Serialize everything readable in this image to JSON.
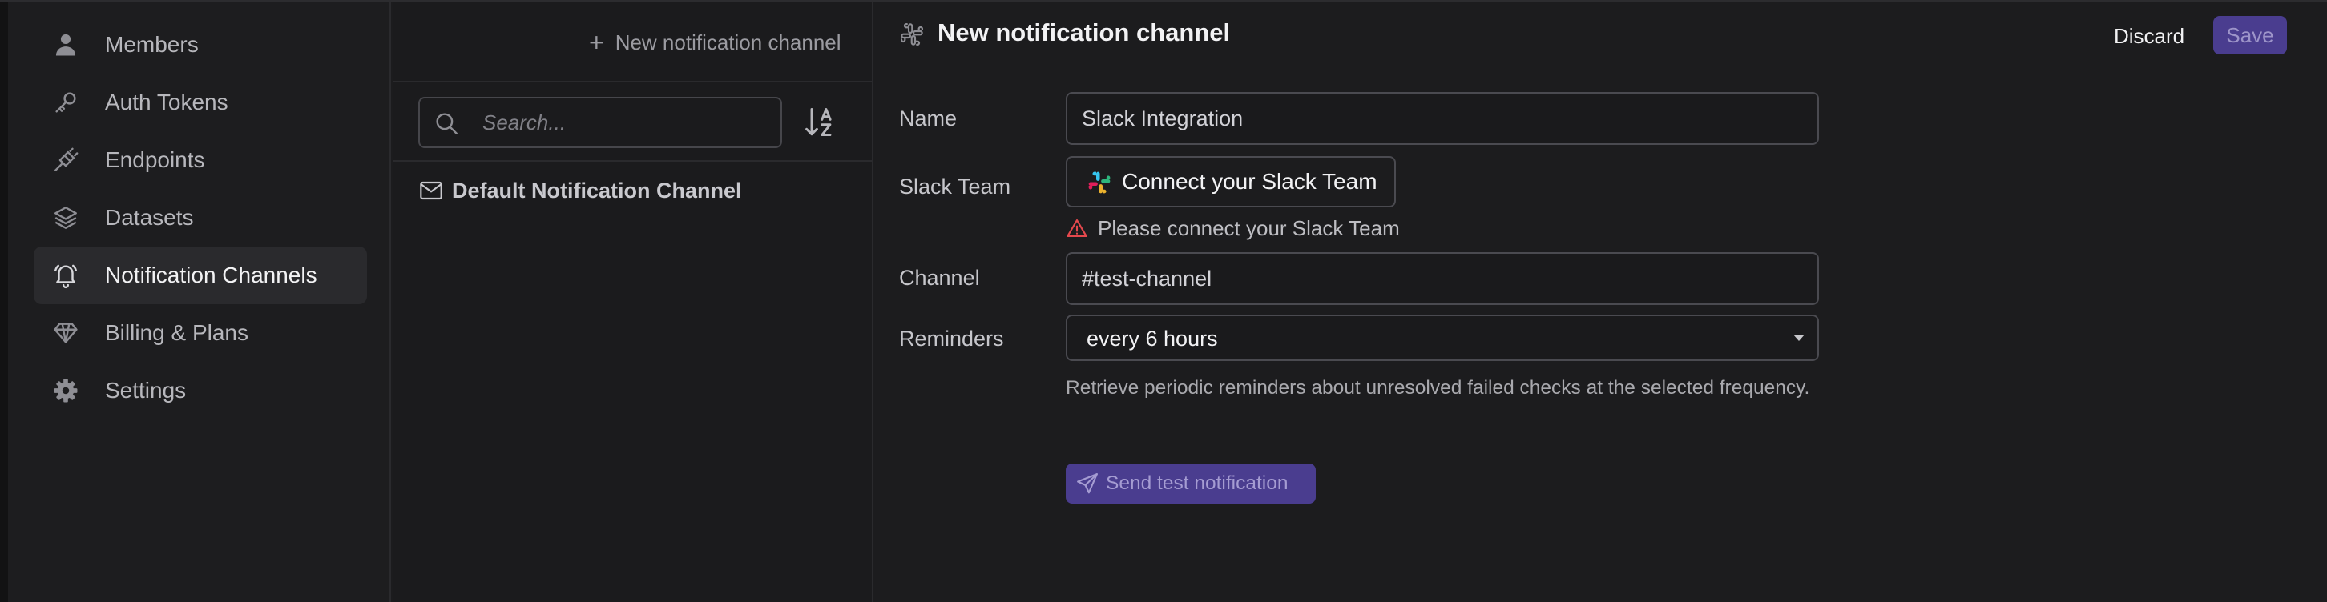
{
  "sidebar": {
    "items": [
      {
        "label": "Members",
        "icon": "user-icon",
        "active": false
      },
      {
        "label": "Auth Tokens",
        "icon": "key-icon",
        "active": false
      },
      {
        "label": "Endpoints",
        "icon": "plug-icon",
        "active": false
      },
      {
        "label": "Datasets",
        "icon": "layers-icon",
        "active": false
      },
      {
        "label": "Notification Channels",
        "icon": "bell-icon",
        "active": true
      },
      {
        "label": "Billing & Plans",
        "icon": "diamond-icon",
        "active": false
      },
      {
        "label": "Settings",
        "icon": "gear-icon",
        "active": false
      }
    ]
  },
  "list": {
    "new_channel_label": "New notification channel",
    "search_placeholder": "Search...",
    "sort_icon": "sort-az-icon",
    "items": [
      {
        "label": "Default Notification Channel",
        "icon": "mail-icon"
      }
    ]
  },
  "main": {
    "title": "New notification channel",
    "title_icon": "slack-icon",
    "discard_label": "Discard",
    "save_label": "Save",
    "name_label": "Name",
    "name_value": "Slack Integration",
    "slack_team_label": "Slack Team",
    "connect_label": "Connect your Slack Team",
    "error_text": "Please connect your Slack Team",
    "channel_label": "Channel",
    "channel_value": "#test-channel",
    "reminders_label": "Reminders",
    "reminders_value": "every 6 hours",
    "helper_text": "Retrieve periodic reminders about unresolved failed checks at the selected frequency.",
    "test_label": "Send test notification"
  },
  "colors": {
    "accent": "#4a3d8f",
    "error": "#e5484d",
    "background": "#1c1c1e",
    "border": "#4a4a50"
  }
}
